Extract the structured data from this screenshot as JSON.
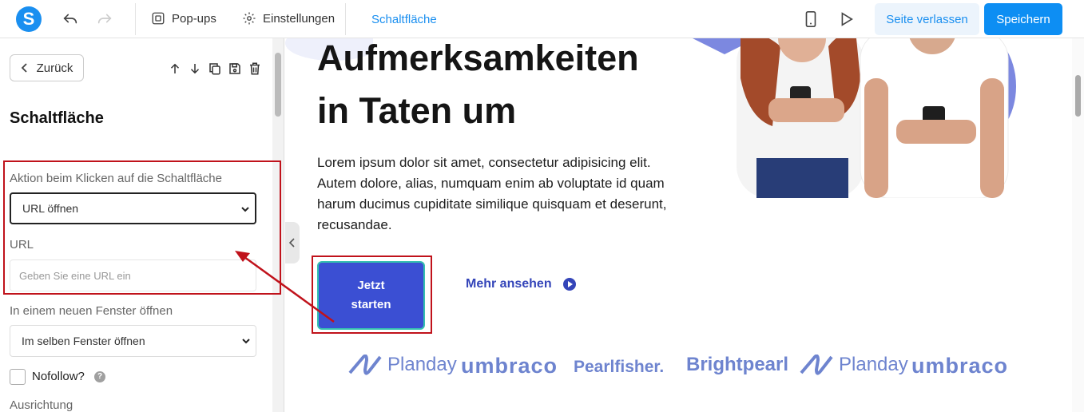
{
  "topbar": {
    "logo": "S",
    "popups_label": "Pop-ups",
    "settings_label": "Einstellungen",
    "context_title": "Schaltfläche",
    "leave_label": "Seite verlassen",
    "save_label": "Speichern"
  },
  "panel": {
    "back_label": "Zurück",
    "title": "Schaltfläche",
    "action_label": "Aktion beim Klicken auf die Schaltfläche",
    "action_value": "URL öffnen",
    "url_label": "URL",
    "url_placeholder": "Geben Sie eine URL ein",
    "window_label": "In einem neuen Fenster öffnen",
    "window_value": "Im selben Fenster öffnen",
    "nofollow_label": "Nofollow?",
    "help_glyph": "?",
    "align_label": "Ausrichtung"
  },
  "canvas": {
    "hero_line1": "Aufmerksamkeiten",
    "hero_line2": "in Taten um",
    "hero_text": "Lorem ipsum dolor sit amet, consectetur adipisicing elit. Autem dolore, alias, numquam enim ab voluptate id quam harum ducimus cupiditate similique quisquam et deserunt, recusandae.",
    "cta_line1": "Jetzt",
    "cta_line2": "starten",
    "more_label": "Mehr ansehen",
    "logos": [
      "Planday",
      "umbraco",
      "Pearlfisher.",
      "Brightpearl",
      "Planday",
      "umbraco"
    ]
  },
  "colors": {
    "brand": "#1a8ff0",
    "cta": "#3b4fd3",
    "annotation": "#c0121b"
  }
}
